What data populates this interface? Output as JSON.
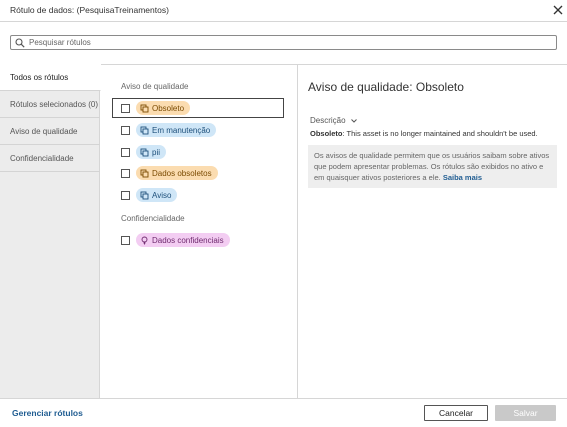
{
  "dialog": {
    "title": "Rótulo de dados: (PesquisaTreinamentos)"
  },
  "search": {
    "placeholder": "Pesquisar rótulos"
  },
  "nav": {
    "items": [
      {
        "label": "Todos os rótulos",
        "active": true
      },
      {
        "label": "Rótulos selecionados (0)"
      },
      {
        "label": "Aviso de qualidade"
      },
      {
        "label": "Confidencialidade"
      }
    ]
  },
  "labels": {
    "quality_section": "Aviso de qualidade",
    "quality": [
      {
        "label": "Obsoleto",
        "color": "orange",
        "icon": "copy-icon",
        "checked": false
      },
      {
        "label": "Em manutenção",
        "color": "blue",
        "icon": "copy-icon",
        "checked": false
      },
      {
        "label": "pii",
        "color": "blue",
        "icon": "copy-icon",
        "checked": false
      },
      {
        "label": "Dados obsoletos",
        "color": "orange",
        "icon": "copy-icon",
        "checked": false
      },
      {
        "label": "Aviso",
        "color": "blue",
        "icon": "copy-icon",
        "checked": false
      }
    ],
    "confidentiality_section": "Confidencialidade",
    "confidentiality": [
      {
        "label": "Dados confidenciais",
        "color": "purple",
        "icon": "bulb-icon",
        "checked": false
      }
    ]
  },
  "detail": {
    "title": "Aviso de qualidade: Obsoleto",
    "description_toggle": "Descrição",
    "description_name": "Obsoleto",
    "description_text": ": This asset is no longer maintained and shouldn't be used.",
    "info_text": "Os avisos de qualidade permitem que os usuários saibam sobre ativos que podem apresentar problemas. Os rótulos são exibidos no ativo e em quaisquer ativos posteriores a ele.",
    "info_link": "Saiba mais"
  },
  "footer": {
    "manage_link": "Gerenciar rótulos",
    "cancel": "Cancelar",
    "save": "Salvar"
  },
  "colors": {
    "orange_chip": "#fbdcb0",
    "blue_chip": "#cfe6f7",
    "purple_chip": "#f3cdf2",
    "link": "#1f5c91"
  }
}
